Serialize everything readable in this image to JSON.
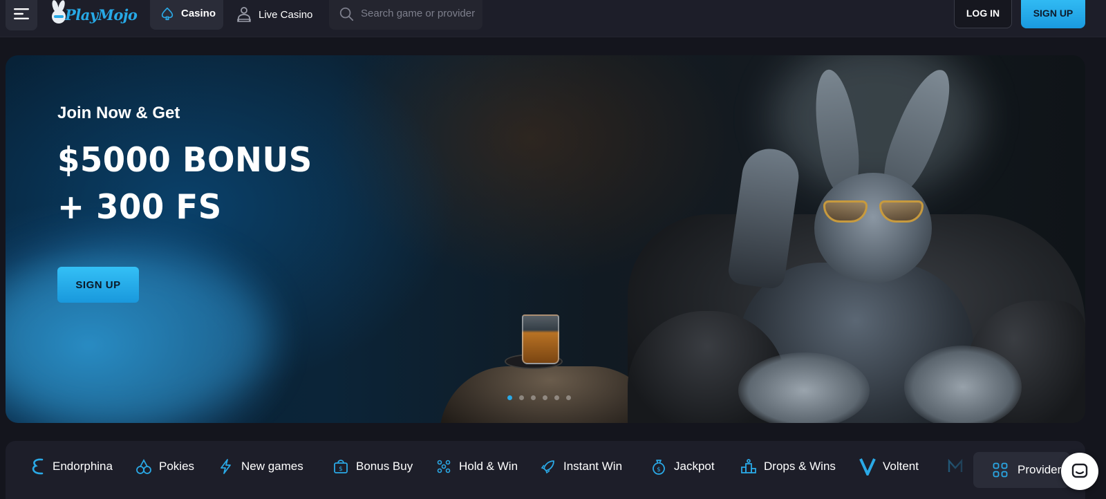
{
  "header": {
    "logo_text": "PlayMojo",
    "nav": [
      {
        "label": "Casino",
        "icon": "spade-icon",
        "active": true
      },
      {
        "label": "Live Casino",
        "icon": "dealer-icon",
        "active": false
      }
    ],
    "search": {
      "placeholder": "Search game or provider",
      "value": ""
    },
    "login_label": "LOG IN",
    "signup_label": "SIGN UP"
  },
  "hero": {
    "subtitle": "Join Now & Get",
    "title_line1": "$5000 BONUS",
    "title_line2": "+ 300 FS",
    "cta_label": "SIGN UP",
    "slides_total": 6,
    "slide_active": 1
  },
  "categories": [
    {
      "label": "Endorphina",
      "icon": "endorphina-icon"
    },
    {
      "label": "Pokies",
      "icon": "cherries-icon"
    },
    {
      "label": "New games",
      "icon": "lightning-icon"
    },
    {
      "label": "Bonus Buy",
      "icon": "gift-bag-icon"
    },
    {
      "label": "Hold & Win",
      "icon": "grid-dots-icon"
    },
    {
      "label": "Instant Win",
      "icon": "rocket-icon"
    },
    {
      "label": "Jackpot",
      "icon": "money-bag-icon"
    },
    {
      "label": "Drops & Wins",
      "icon": "podium-icon"
    },
    {
      "label": "Voltent",
      "icon": "voltent-icon"
    },
    {
      "label": "",
      "icon": "m-provider-icon"
    }
  ],
  "providers_label": "Providers",
  "colors": {
    "accent": "#2aa9e6",
    "header_bg": "#1d1e29",
    "page_bg": "#14151d"
  }
}
